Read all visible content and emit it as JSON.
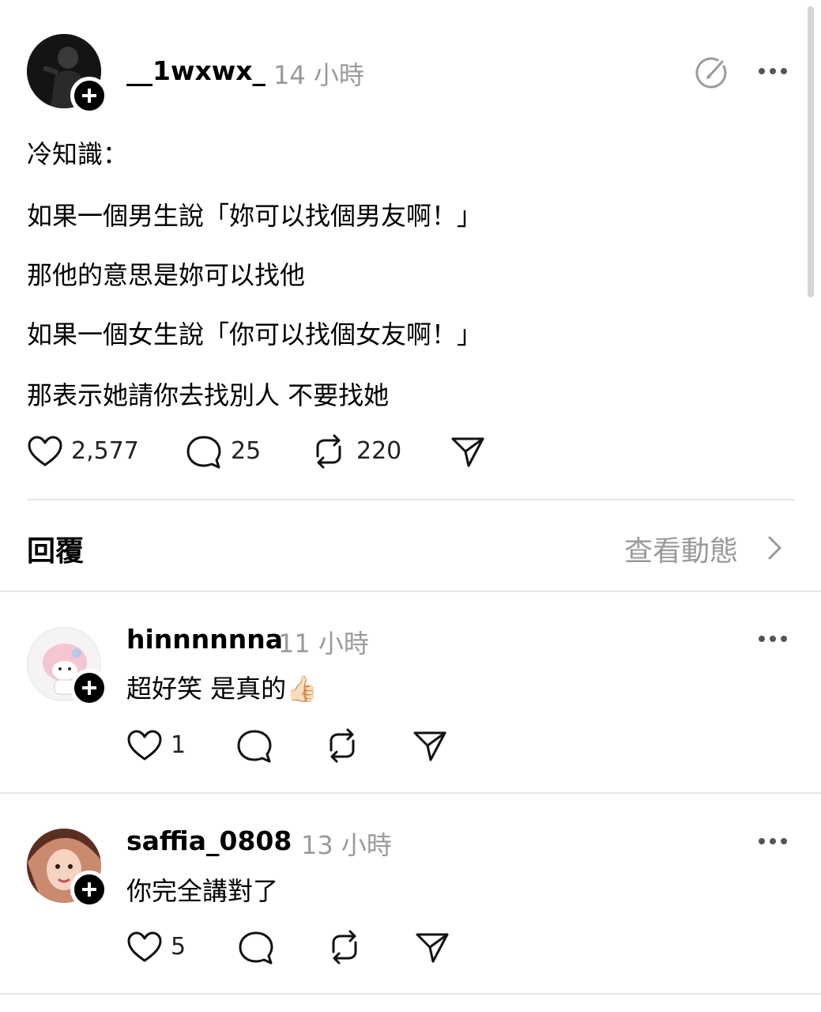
{
  "post": {
    "author": "__1wxwx_",
    "time": "14 小時",
    "lines": [
      "冷知識：",
      "如果一個男生說「妳可以找個男友啊！」",
      "那他的意思是妳可以找他",
      "如果一個女生說「你可以找個女友啊！」",
      "那表示她請你去找別人 不要找她"
    ],
    "likes": "2,577",
    "comments": "25",
    "reposts": "220"
  },
  "replies_header": {
    "title": "回覆",
    "view_activity": "查看動態"
  },
  "replies": [
    {
      "author": "hinnnnnna",
      "time": "11 小時",
      "text": "超好笑 是真的",
      "emoji": "👍🏻",
      "likes": "1"
    },
    {
      "author": "saffia_0808",
      "time": "13 小時",
      "text": "你完全講對了",
      "likes": "5"
    }
  ],
  "icons": {
    "like": "heart-icon",
    "comment": "comment-bubble-icon",
    "repost": "repost-icon",
    "share": "send-icon",
    "more": "more-dots-icon",
    "follow": "plus-icon",
    "chevron": "chevron-right-icon",
    "edit": "edit-circle-icon"
  },
  "colors": {
    "text": "#000000",
    "muted": "#9a9a9a",
    "divider": "#e6e6e6"
  }
}
